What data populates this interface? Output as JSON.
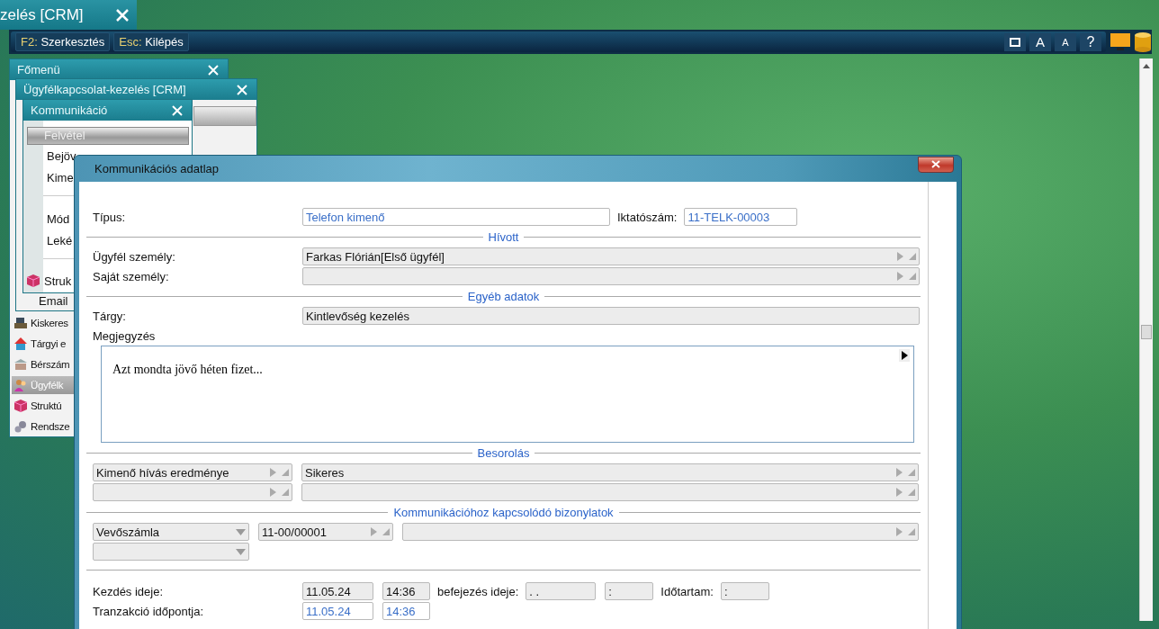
{
  "back_window": {
    "title": "zelés [CRM]"
  },
  "toolbar": {
    "shortcuts": [
      {
        "key": "F2:",
        "label": "Szerkesztés"
      },
      {
        "key": "Esc:",
        "label": "Kilépés"
      }
    ],
    "font_buttons": [
      "A",
      "A",
      "?"
    ]
  },
  "main_menu": {
    "title": "Főmenü",
    "items": [
      {
        "label": "Kiskeres",
        "kind": "register",
        "selected": false
      },
      {
        "label": "Tárgyi e",
        "kind": "house",
        "selected": false
      },
      {
        "label": "Bérszám",
        "kind": "money",
        "selected": false
      },
      {
        "label": "Ügyfélk",
        "kind": "people",
        "selected": true
      },
      {
        "label": "Struktú",
        "kind": "cube",
        "selected": false
      },
      {
        "label": "Rendsze",
        "kind": "gear",
        "selected": false
      }
    ]
  },
  "crm_window": {
    "title": "Ügyfélkapcsolat-kezelés [CRM]",
    "item": "Email"
  },
  "comm_menu": {
    "title": "Kommunikáció",
    "header": "Felvétel",
    "groups": [
      [
        {
          "label": "Bejöv",
          "kind": "text"
        },
        {
          "label": "Kime",
          "kind": "text"
        }
      ],
      [
        {
          "label": "Mód",
          "kind": "text"
        },
        {
          "label": "Leké",
          "kind": "text"
        }
      ],
      [
        {
          "label": "Struk",
          "kind": "cube"
        }
      ]
    ]
  },
  "dialog": {
    "title": "Kommunikációs adatlap",
    "type": {
      "label": "Típus:",
      "value": "Telefon kimenő"
    },
    "number": {
      "label": "Iktatószám:",
      "value": "11-TELK-00003"
    },
    "called": {
      "title": "Hívott",
      "rows": [
        {
          "label": "Ügyfél személy:",
          "value": "Farkas Flórián[Első ügyfél]"
        },
        {
          "label": "Saját személy:"
        }
      ]
    },
    "other": {
      "title": "Egyéb adatok",
      "subject_label": "Tárgy:",
      "subject": "Kintlevőség kezelés",
      "note_label": "Megjegyzés",
      "note": "Azt mondta jövő héten fizet..."
    },
    "classification": {
      "title": "Besorolás",
      "rows": [
        {
          "category": "Kimenő hívás eredménye",
          "value": "Sikeres"
        },
        {}
      ]
    },
    "documents": {
      "title": "Kommunikációhoz kapcsolódó bizonylatok",
      "doc_type": "Vevőszámla",
      "doc_number": "11-00/00001"
    },
    "times": {
      "start_label": "Kezdés ideje:",
      "start_date": "11.05.24",
      "start_time": "14:36",
      "end_label": "befejezés ideje:",
      "end_date": ". .",
      "end_time": ":",
      "duration_label": "Időtartam:",
      "duration": ":",
      "tx_label": "Tranzakció időpontja:",
      "tx_date": "11.05.24",
      "tx_time": "14:36"
    }
  }
}
